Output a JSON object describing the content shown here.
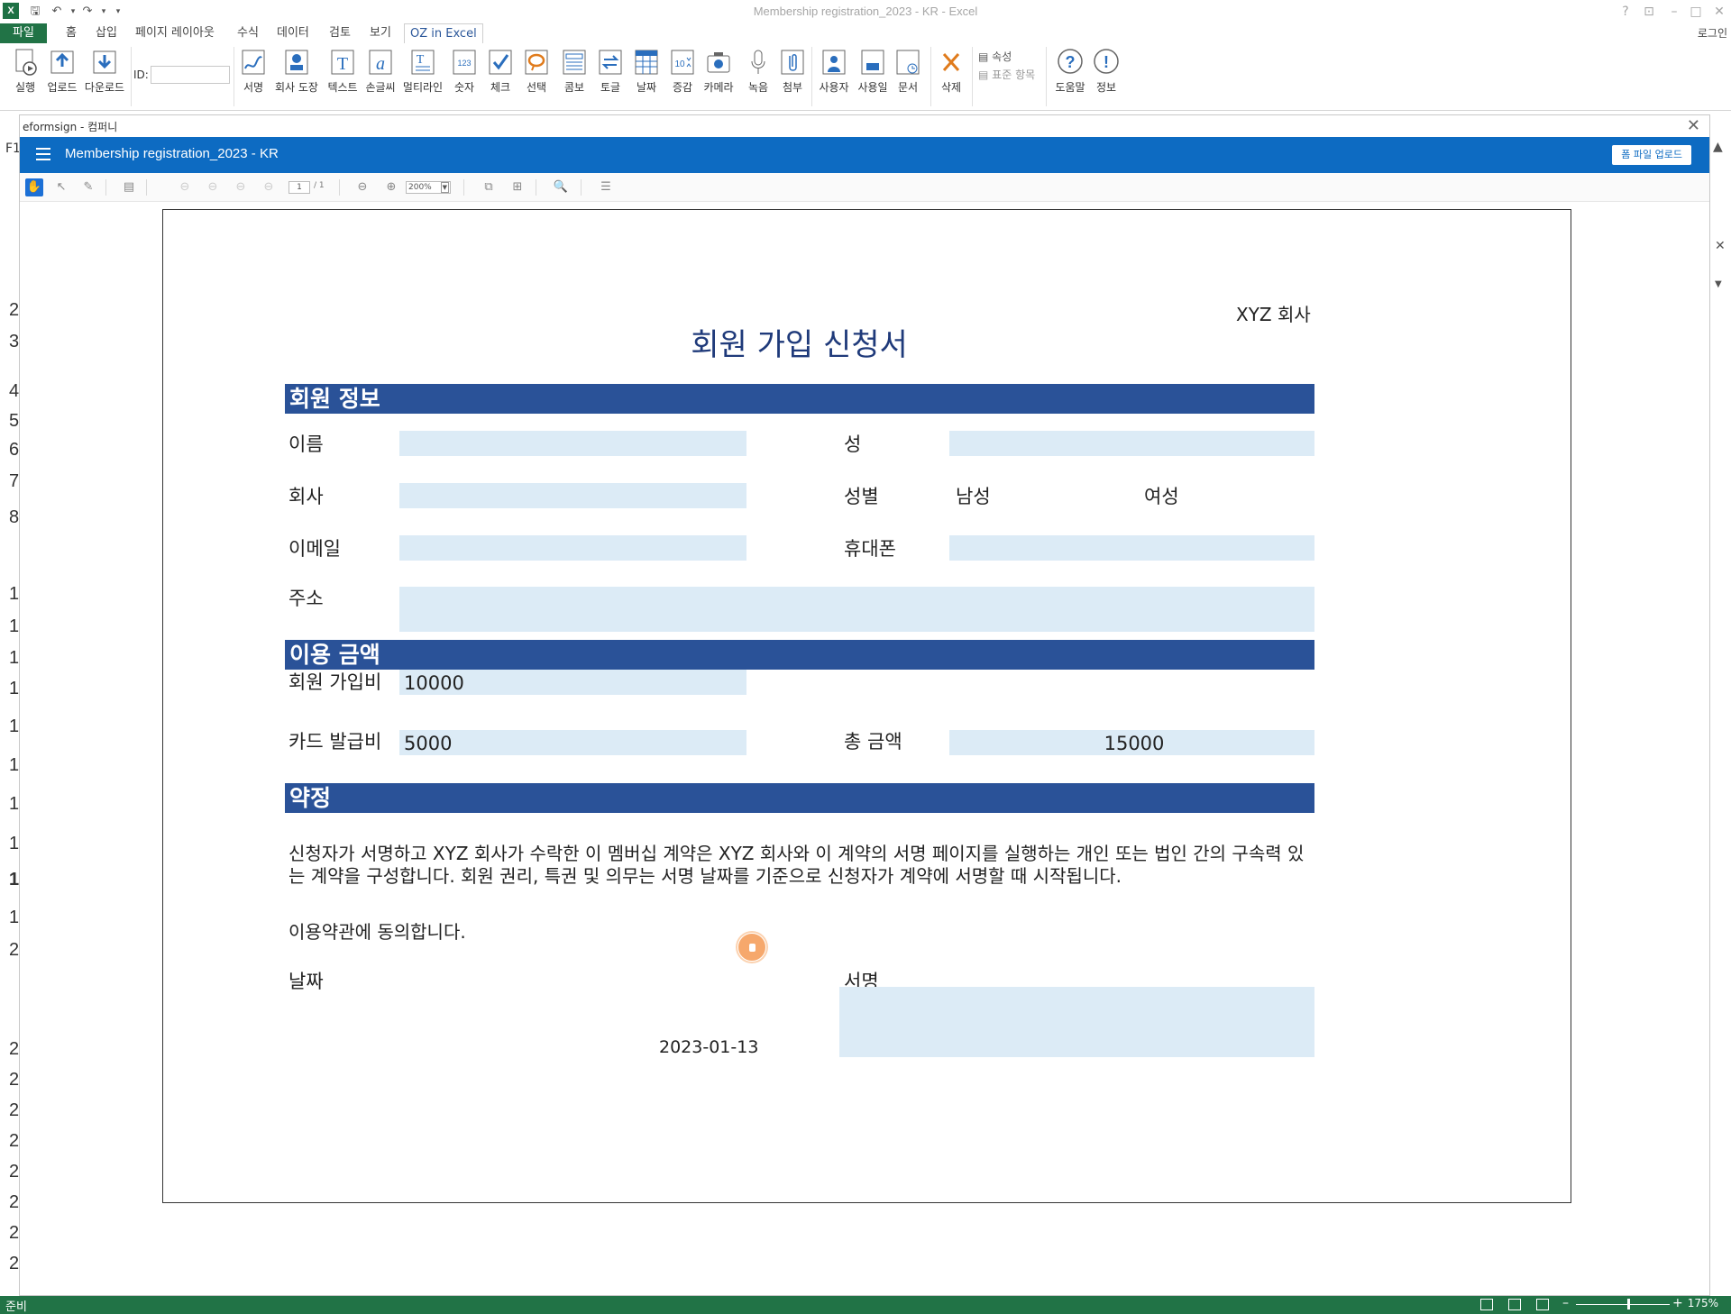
{
  "excel": {
    "window_title": "Membership registration_2023 - KR - Excel",
    "login": "로그인",
    "tabs": [
      "파일",
      "홈",
      "삽입",
      "페이지 레이아웃",
      "수식",
      "데이터",
      "검토",
      "보기",
      "OZ in Excel"
    ],
    "active_tab": "OZ in Excel",
    "ribbon": {
      "left_buttons": [
        "실행",
        "업로드",
        "다운로드"
      ],
      "id_label": "ID:",
      "id_value": "",
      "components": [
        "서명",
        "회사 도장",
        "텍스트",
        "손글씨",
        "멀티라인",
        "숫자",
        "체크",
        "선택",
        "콤보",
        "토글",
        "날짜",
        "증감",
        "카메라",
        "녹음",
        "첨부"
      ],
      "user_buttons": [
        "사용자",
        "사용일",
        "문서"
      ],
      "delete": "삭제",
      "props": [
        "속성",
        "표준 항목"
      ],
      "help": [
        "도움말",
        "정보"
      ]
    },
    "status": "준비",
    "zoom": "175%",
    "name_box": "F1",
    "row_headers": [
      "2",
      "3",
      "4",
      "5",
      "6",
      "7",
      "8",
      "1",
      "1",
      "1",
      "1",
      "1",
      "1",
      "1",
      "1",
      "1",
      "1",
      "2",
      "2",
      "2",
      "2",
      "2",
      "2",
      "2",
      "2",
      "2"
    ]
  },
  "eformsign": {
    "window_caption": "eformsign - 컴퍼니",
    "title": "Membership registration_2023 - KR",
    "upload_button": "폼 파일 업로드",
    "toolbar": {
      "page_current": "1",
      "page_total": "/ 1",
      "zoom": "200%"
    }
  },
  "form": {
    "company": "XYZ 회사",
    "title": "회원 가입 신청서",
    "sections": {
      "member_info": "회원 정보",
      "fees": "이용 금액",
      "agreement": "약정"
    },
    "labels": {
      "first_name": "이름",
      "last_name": "성",
      "company": "회사",
      "gender": "성별",
      "email": "이메일",
      "mobile": "휴대폰",
      "address": "주소",
      "join_fee": "회원 가입비",
      "card_fee": "카드 발급비",
      "total": "총 금액",
      "date": "날짜",
      "signature": "서명"
    },
    "gender_options": [
      "남성",
      "여성"
    ],
    "values": {
      "first_name": "",
      "last_name": "",
      "company": "",
      "email": "",
      "mobile": "",
      "address": "",
      "join_fee": "10000",
      "card_fee": "5000",
      "total": "15000",
      "date": "2023-01-13"
    },
    "agreement_text": "신청자가 서명하고 XYZ 회사가 수락한 이 멤버십 계약은 XYZ 회사와 이 계약의 서명 페이지를 실행하는 개인 또는 법인 간의 구속력 있는 계약을 구성합니다. 회원 권리, 특권 및 의무는 서명 날짜를 기준으로 신청자가 계약에 서명할 때 시작됩니다.",
    "consent": "이용약관에 동의합니다."
  },
  "colors": {
    "excel_green": "#217346",
    "eformsign_blue": "#0d6bc2",
    "section_blue": "#2a5298",
    "field_bg": "#dcebf6",
    "title_navy": "#1f3a7a"
  }
}
